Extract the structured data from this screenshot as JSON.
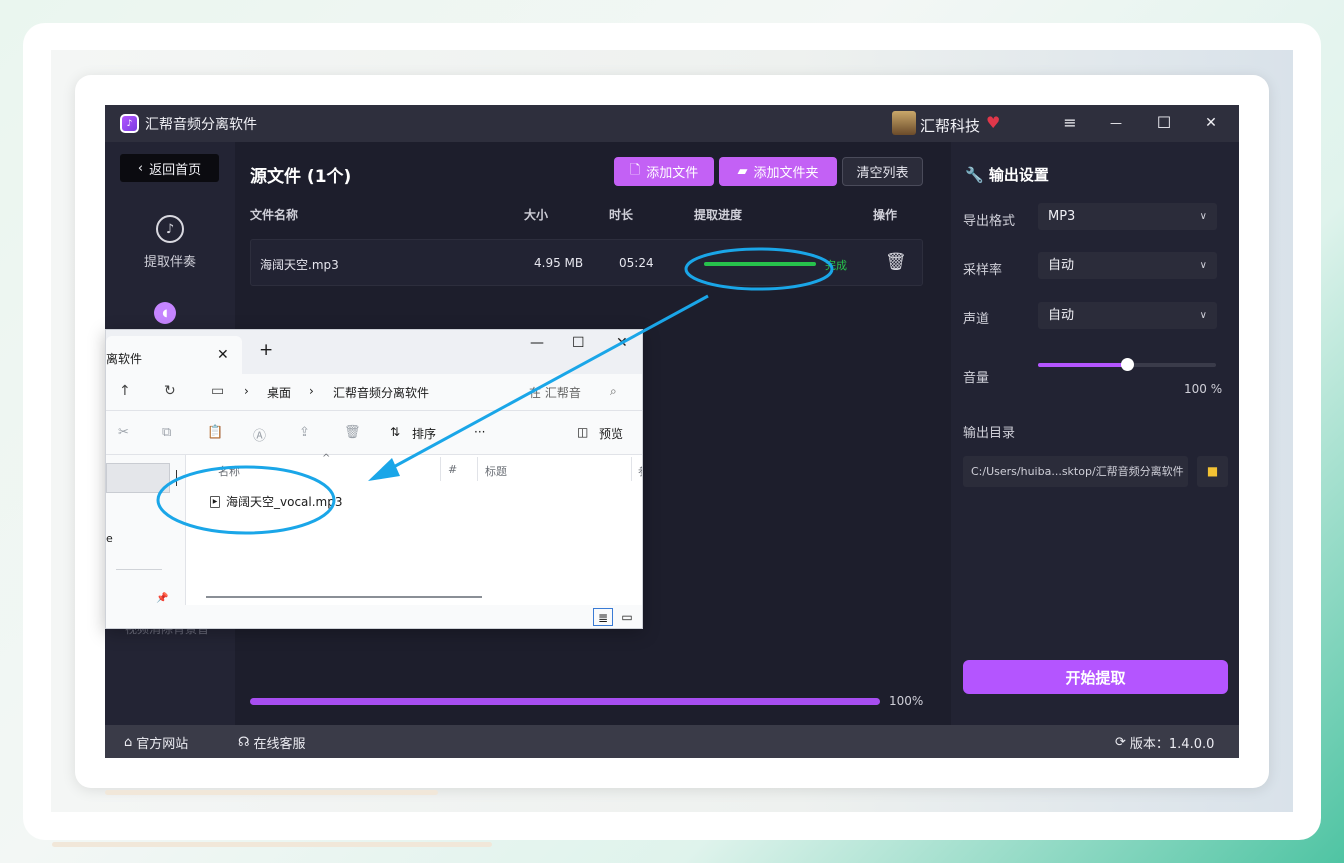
{
  "app": {
    "title": "汇帮音频分离软件",
    "brand": "汇帮科技",
    "window": {
      "menu": "≡",
      "minimize": "—",
      "maximize": "☐",
      "close": "✕"
    }
  },
  "sidebar": {
    "back": "返回首页",
    "items": [
      {
        "label": "提取伴奏"
      }
    ],
    "bottom_text": "视频消除背景音"
  },
  "main": {
    "title": "源文件 (1个)",
    "toolbar": {
      "add_file": "添加文件",
      "add_folder": "添加文件夹",
      "clear": "清空列表"
    },
    "columns": {
      "name": "文件名称",
      "size": "大小",
      "duration": "时长",
      "progress": "提取进度",
      "action": "操作"
    },
    "files": [
      {
        "name": "海阔天空.mp3",
        "size": "4.95 MB",
        "duration": "05:24",
        "progress": 1.0,
        "status": "完成"
      }
    ],
    "overall_progress": 1.0,
    "overall_progress_label": "100%"
  },
  "settings": {
    "title": "输出设置",
    "format_label": "导出格式",
    "format_value": "MP3",
    "rate_label": "采样率",
    "rate_value": "自动",
    "channel_label": "声道",
    "channel_value": "自动",
    "volume_label": "音量",
    "volume_fraction": 0.5,
    "volume_pct": "100 %",
    "dir_label": "输出目录",
    "dir_value": "C:/Users/huiba...sktop/汇帮音频分离软件",
    "start": "开始提取"
  },
  "footer": {
    "website": "官方网站",
    "support": "在线客服",
    "version": "版本：1.4.0.0"
  },
  "explorer": {
    "tab_title": "离软件",
    "new_tab": "+",
    "breadcrumb": [
      "桌面",
      "汇帮音频分离软件"
    ],
    "search_placeholder": "在 汇帮音",
    "sort": "排序",
    "more": "···",
    "preview": "预览",
    "columns": {
      "name": "名称",
      "num": "#",
      "title": "标题",
      "extra": "参"
    },
    "nav_item": "e",
    "files": [
      {
        "name": "海阔天空_vocal.mp3"
      }
    ]
  },
  "colors": {
    "accent": "#b455ff",
    "success": "#27c24c",
    "annotation": "#1aa6e8"
  }
}
